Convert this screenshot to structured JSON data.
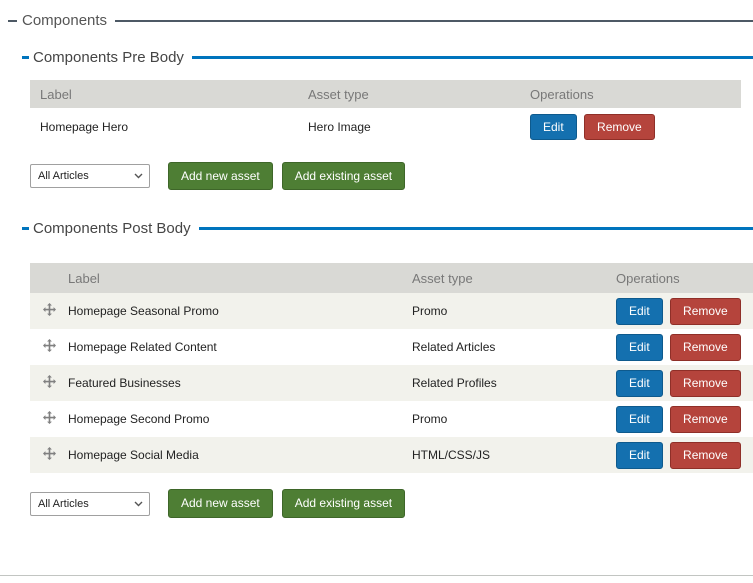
{
  "page": {
    "title": "Components"
  },
  "colors": {
    "accent_blue": "#0074bd",
    "outer_line": "#4d5965",
    "edit_blue": "#1470af",
    "remove_red": "#b5443c",
    "add_green": "#4e7e34",
    "header_bg": "#d9d9d5",
    "stripe": "#f2f2ec"
  },
  "buttons": {
    "edit": "Edit",
    "remove": "Remove",
    "add_new": "Add new asset",
    "add_existing": "Add existing asset"
  },
  "filter_select": {
    "value": "All Articles"
  },
  "pre_body": {
    "title": "Components Pre Body",
    "headers": {
      "label": "Label",
      "asset_type": "Asset type",
      "operations": "Operations"
    },
    "rows": [
      {
        "label": "Homepage Hero",
        "asset_type": "Hero Image"
      }
    ]
  },
  "post_body": {
    "title": "Components Post Body",
    "headers": {
      "label": "Label",
      "asset_type": "Asset type",
      "operations": "Operations"
    },
    "rows": [
      {
        "label": "Homepage Seasonal Promo",
        "asset_type": "Promo"
      },
      {
        "label": "Homepage Related Content",
        "asset_type": "Related Articles"
      },
      {
        "label": "Featured Businesses",
        "asset_type": "Related Profiles"
      },
      {
        "label": "Homepage Second Promo",
        "asset_type": "Promo"
      },
      {
        "label": "Homepage Social Media",
        "asset_type": "HTML/CSS/JS"
      }
    ]
  }
}
